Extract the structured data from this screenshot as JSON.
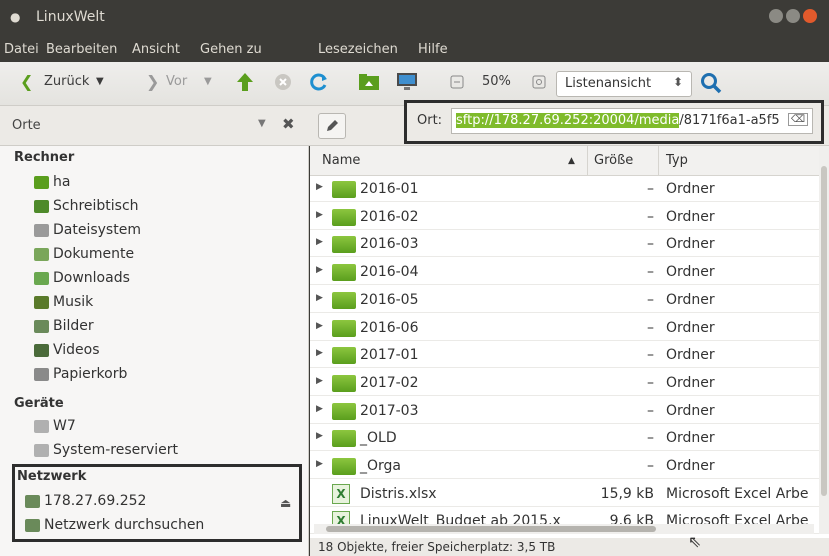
{
  "window": {
    "title": "LinuxWelt"
  },
  "menu": [
    "Datei",
    "Bearbeiten",
    "Ansicht",
    "Gehen zu",
    "Lesezeichen",
    "Hilfe"
  ],
  "toolbar": {
    "back_label": "Zurück",
    "forward_label": "Vor",
    "zoom": "50%",
    "view_mode": "Listenansicht"
  },
  "location": {
    "places_label": "Orte",
    "label": "Ort:",
    "path_selected": "sftp://178.27.69.252:20004/media",
    "path_rest": "/8171f6a1-a5f5"
  },
  "sidebar": {
    "sections": [
      {
        "title": "Rechner",
        "items": [
          "ha",
          "Schreibtisch",
          "Dateisystem",
          "Dokumente",
          "Downloads",
          "Musik",
          "Bilder",
          "Videos",
          "Papierkorb"
        ]
      },
      {
        "title": "Geräte",
        "items": [
          "W7",
          "System-reserviert"
        ]
      },
      {
        "title": "Netzwerk",
        "items": [
          "178.27.69.252",
          "Netzwerk durchsuchen"
        ]
      }
    ]
  },
  "columns": {
    "name": "Name",
    "size": "Größe",
    "type": "Typ"
  },
  "files": [
    {
      "name": "2016-01",
      "size": "–",
      "type": "Ordner",
      "kind": "folder"
    },
    {
      "name": "2016-02",
      "size": "–",
      "type": "Ordner",
      "kind": "folder"
    },
    {
      "name": "2016-03",
      "size": "–",
      "type": "Ordner",
      "kind": "folder"
    },
    {
      "name": "2016-04",
      "size": "–",
      "type": "Ordner",
      "kind": "folder"
    },
    {
      "name": "2016-05",
      "size": "–",
      "type": "Ordner",
      "kind": "folder"
    },
    {
      "name": "2016-06",
      "size": "–",
      "type": "Ordner",
      "kind": "folder"
    },
    {
      "name": "2017-01",
      "size": "–",
      "type": "Ordner",
      "kind": "folder"
    },
    {
      "name": "2017-02",
      "size": "–",
      "type": "Ordner",
      "kind": "folder"
    },
    {
      "name": "2017-03",
      "size": "–",
      "type": "Ordner",
      "kind": "folder"
    },
    {
      "name": "_OLD",
      "size": "–",
      "type": "Ordner",
      "kind": "folder"
    },
    {
      "name": "_Orga",
      "size": "–",
      "type": "Ordner",
      "kind": "folder"
    },
    {
      "name": "Distris.xlsx",
      "size": "15,9 kB",
      "type": "Microsoft Excel Arbe",
      "kind": "xlsx"
    },
    {
      "name": "LinuxWelt_Budget ab 2015.x",
      "size": "9,6 kB",
      "type": "Microsoft Excel Arbe",
      "kind": "xlsx"
    }
  ],
  "status": "18 Objekte, freier Speicherplatz: 3,5 TB"
}
